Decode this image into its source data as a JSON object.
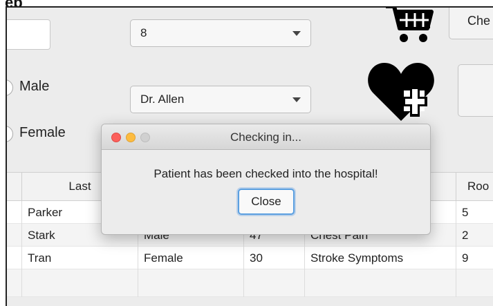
{
  "header": {
    "partial_title": "ep"
  },
  "form": {
    "id_field_value": "",
    "room_select": {
      "value": "8"
    },
    "doctor_select": {
      "value": "Dr. Allen"
    },
    "gender": [
      {
        "label": "Male"
      },
      {
        "label": "Female"
      }
    ],
    "checkin_button_label": "Che",
    "second_button_label": ""
  },
  "table": {
    "columns": [
      "Last",
      "",
      "",
      "",
      "Roo"
    ],
    "rows": [
      [
        "Parker",
        "",
        "",
        "",
        "5"
      ],
      [
        "Stark",
        "Male",
        "47",
        "Chest Pain",
        "2"
      ],
      [
        "Tran",
        "Female",
        "30",
        "Stroke Symptoms",
        "9"
      ],
      [
        "",
        "",
        "",
        "",
        ""
      ]
    ]
  },
  "dialog": {
    "title": "Checking in...",
    "message": "Patient has been checked into the hospital!",
    "close_label": "Close"
  },
  "icons": [
    "cart-icon",
    "heart-plus-icon"
  ],
  "colors": {
    "close_red": "#fc605b",
    "minimize_yellow": "#fdbc40",
    "focus_blue": "#5a9fe0"
  }
}
